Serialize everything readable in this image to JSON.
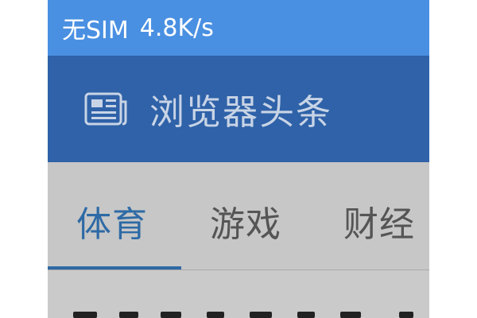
{
  "status_bar": {
    "carrier": "无SIM",
    "speed": "4.8K/s"
  },
  "header": {
    "icon": "newspaper-icon",
    "title": "浏览器头条"
  },
  "tabs": [
    {
      "label": "体育",
      "active": true
    },
    {
      "label": "游戏",
      "active": false
    },
    {
      "label": "财经",
      "active": false
    }
  ],
  "colors": {
    "status_bar_bg": "#4a90e2",
    "header_bg": "#2f62a8",
    "active_tab": "#2e6aa5"
  }
}
